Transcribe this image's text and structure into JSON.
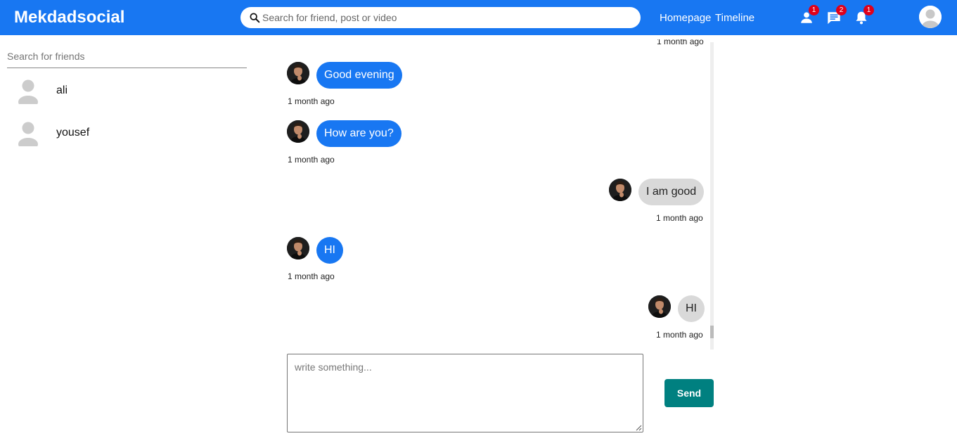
{
  "header": {
    "logo": "Mekdadsocial",
    "search_placeholder": "Search for friend, post or video",
    "nav": {
      "homepage": "Homepage",
      "timeline": "Timeline"
    },
    "badges": {
      "friend_requests": "1",
      "messages": "2",
      "notifications": "1"
    }
  },
  "sidebar": {
    "search_placeholder": "Search for friends",
    "friends": [
      {
        "name": "ali"
      },
      {
        "name": "yousef"
      }
    ]
  },
  "chat": {
    "top_partial_time": "1 month ago",
    "messages": [
      {
        "text": "Good evening",
        "time": "1 month ago",
        "direction": "incoming"
      },
      {
        "text": "How are you?",
        "time": "1 month ago",
        "direction": "incoming"
      },
      {
        "text": "I am good",
        "time": "1 month ago",
        "direction": "outgoing"
      },
      {
        "text": "HI",
        "time": "1 month ago",
        "direction": "incoming"
      },
      {
        "text": "HI",
        "time": "1 month ago",
        "direction": "outgoing"
      }
    ]
  },
  "composer": {
    "placeholder": "write something...",
    "send_label": "Send"
  },
  "colors": {
    "brand": "#1877f2",
    "incoming_bubble": "#1877f2",
    "outgoing_bubble": "#d9d9d9",
    "send_button": "#008080",
    "badge": "#e0001a"
  }
}
